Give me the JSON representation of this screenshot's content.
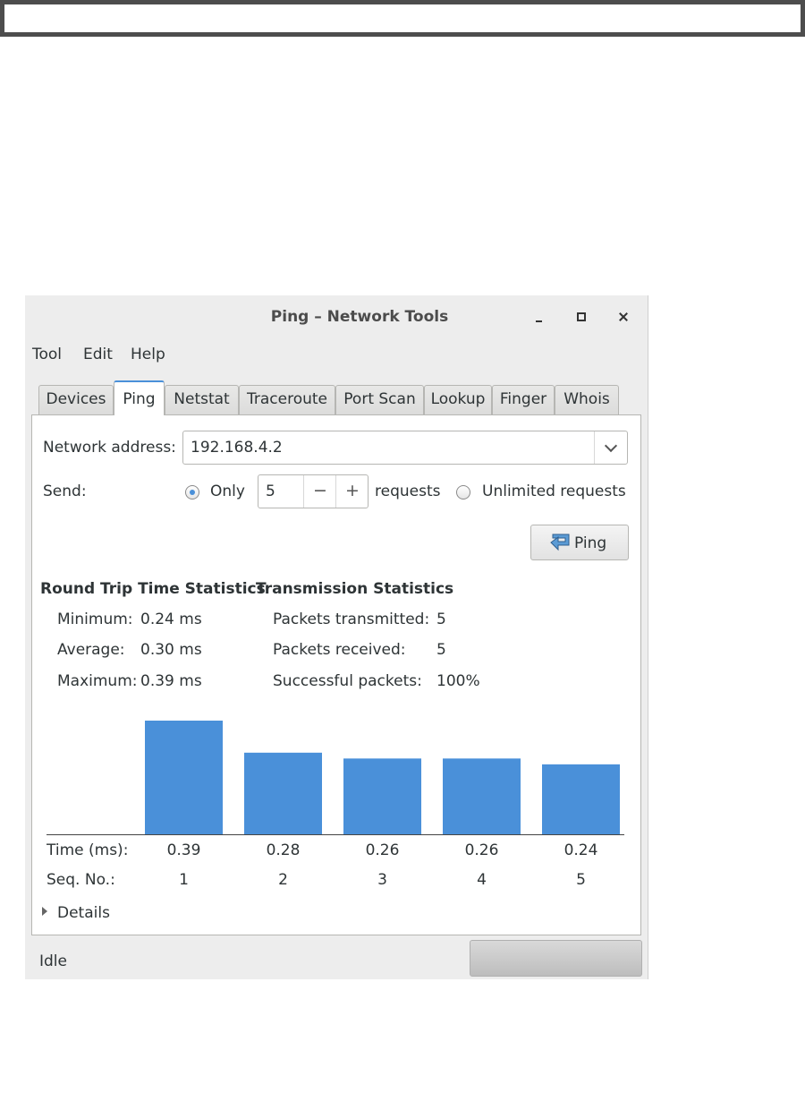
{
  "window": {
    "title": "Ping – Network Tools"
  },
  "menu": [
    "Tool",
    "Edit",
    "Help"
  ],
  "tabs": [
    {
      "label": "Devices",
      "active": false
    },
    {
      "label": "Ping",
      "active": true
    },
    {
      "label": "Netstat",
      "active": false
    },
    {
      "label": "Traceroute",
      "active": false
    },
    {
      "label": "Port Scan",
      "active": false
    },
    {
      "label": "Lookup",
      "active": false
    },
    {
      "label": "Finger",
      "active": false
    },
    {
      "label": "Whois",
      "active": false
    }
  ],
  "form": {
    "address_label": "Network address:",
    "address_value": "192.168.4.2",
    "send_label": "Send:",
    "only_label": "Only",
    "count_value": "5",
    "minus": "−",
    "plus": "+",
    "requests_label": "requests",
    "unlimited_label": "Unlimited requests",
    "mode_selected": "only",
    "ping_button": "Ping"
  },
  "rtt": {
    "title": "Round Trip Time Statistics",
    "minimum_label": "Minimum:",
    "minimum_value": "0.24 ms",
    "average_label": "Average:",
    "average_value": "0.30 ms",
    "maximum_label": "Maximum:",
    "maximum_value": "0.39 ms"
  },
  "transmission": {
    "title": "Transmission Statistics",
    "transmitted_label": "Packets transmitted:",
    "transmitted_value": "5",
    "received_label": "Packets received:",
    "received_value": "5",
    "success_label": "Successful packets:",
    "success_value": "100%"
  },
  "chart_data": {
    "type": "bar",
    "row_labels": [
      "Time (ms):",
      "Seq. No.:"
    ],
    "categories": [
      "1",
      "2",
      "3",
      "4",
      "5"
    ],
    "values": [
      0.39,
      0.28,
      0.26,
      0.26,
      0.24
    ],
    "value_labels": [
      "0.39",
      "0.28",
      "0.26",
      "0.26",
      "0.24"
    ],
    "ylim": [
      0,
      0.39
    ],
    "color": "#4a90d9"
  },
  "details_label": "Details",
  "status": {
    "text": "Idle"
  },
  "colors": {
    "accent": "#4a90d9",
    "window_bg": "#ededed"
  }
}
